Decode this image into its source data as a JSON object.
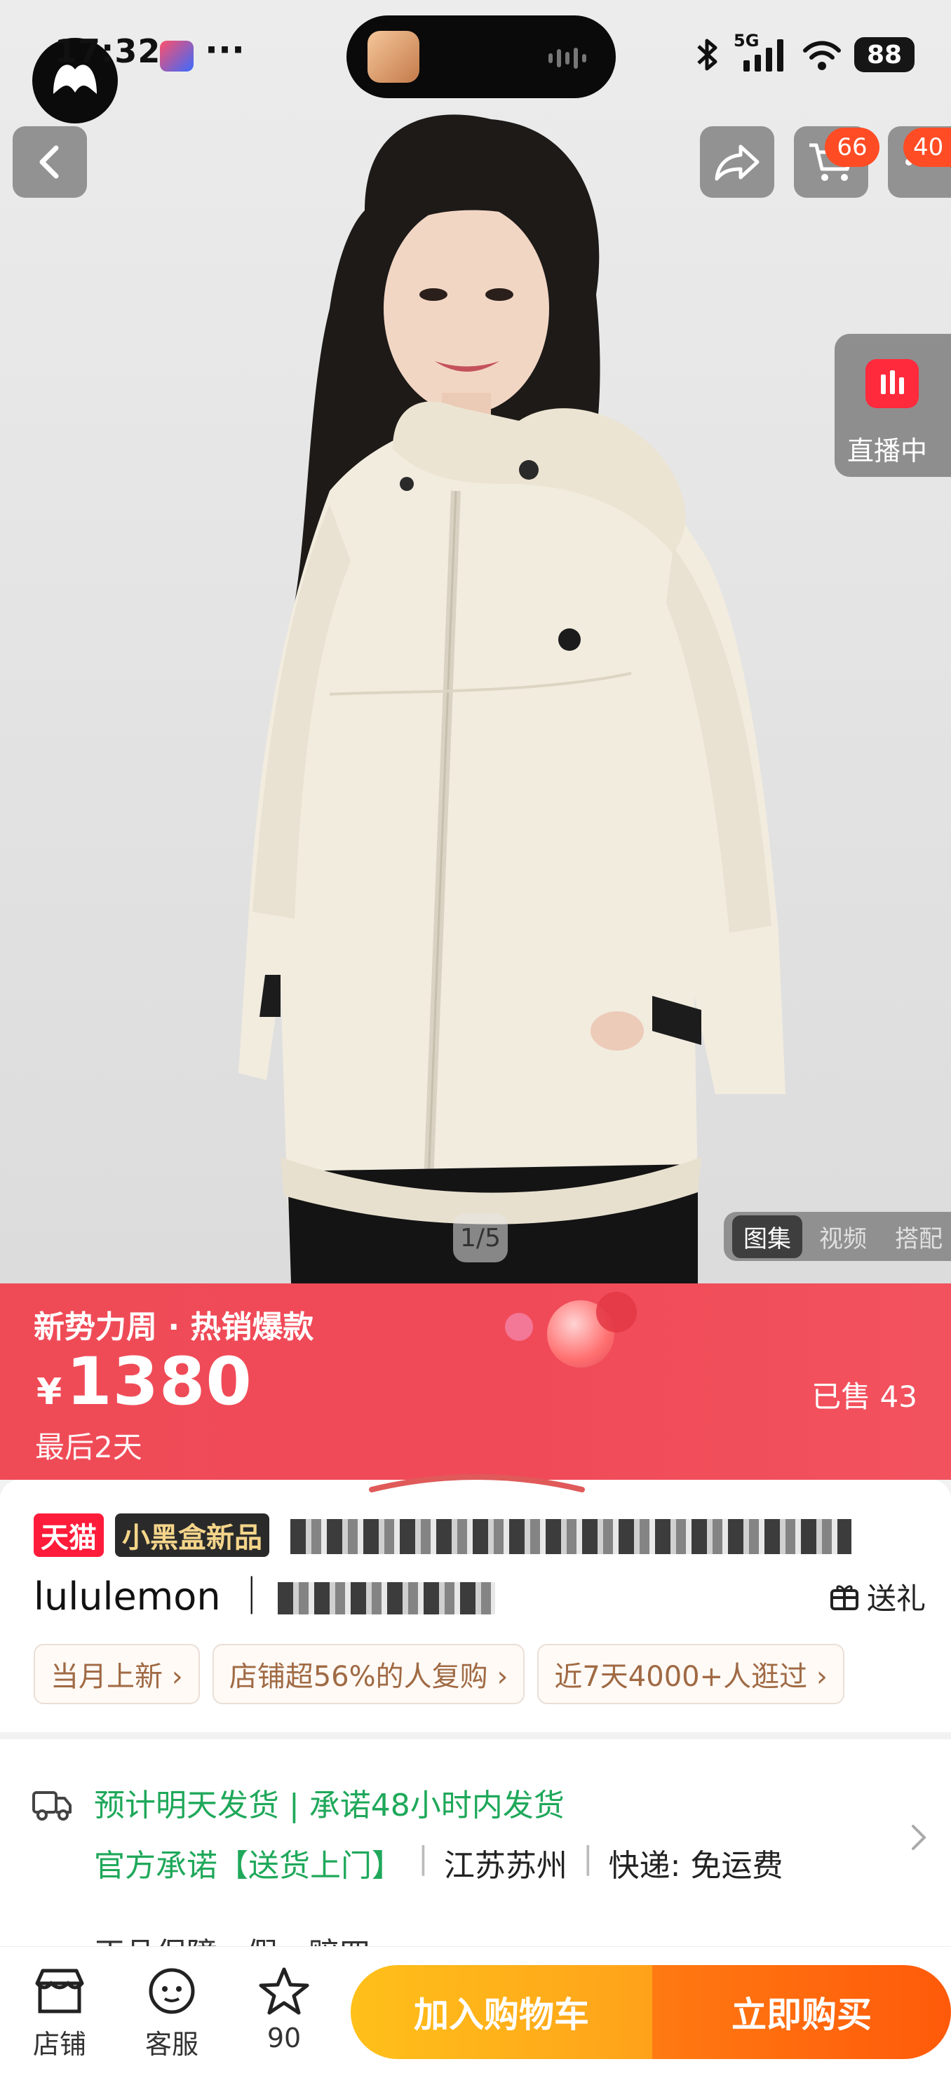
{
  "status_bar": {
    "time": "17:32",
    "more": "···",
    "network": "5G",
    "battery": "88"
  },
  "header": {
    "cart_badge": "66",
    "message_badge": "40"
  },
  "gallery": {
    "live_label": "直播中",
    "counter": "1/5",
    "tabs": [
      "图集",
      "视频",
      "搭配"
    ],
    "active_tab": "图集"
  },
  "promo": {
    "title": "新势力周 · 热销爆款",
    "currency": "¥",
    "price": "1380",
    "sold": "已售 43",
    "days_left": "最后2天"
  },
  "product": {
    "tag_tmall": "天猫",
    "tag_new": "小黑盒新品",
    "name": "lululemon ｜",
    "gift": "送礼",
    "chips": [
      "当月上新 ›",
      "店铺超56%的人复购 ›",
      "近7天4000+人逛过 ›"
    ]
  },
  "shipping": {
    "line1": "预计明天发货 | 承诺48小时内发货",
    "promise": "官方承诺【送货上门】",
    "origin": "江苏苏州",
    "express": "快递: 免运费",
    "line3": "正品保障 · 假一赔四"
  },
  "bottom_bar": {
    "store": "店铺",
    "service": "客服",
    "favorites": "90",
    "add_to_cart": "加入购物车",
    "buy_now": "立即购买"
  },
  "colors": {
    "promo_red": "#f04a58",
    "tmall_red": "#ff1c3a",
    "ship_green": "#1fa85a",
    "cart_yellow": "#ffb01a",
    "buy_orange": "#ff6a0e"
  }
}
